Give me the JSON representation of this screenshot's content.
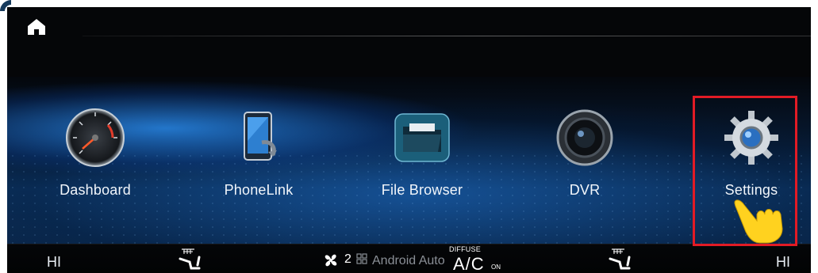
{
  "header": {
    "home_icon": "home-icon"
  },
  "apps": [
    {
      "label": "Dashboard",
      "icon": "speedometer-icon"
    },
    {
      "label": "PhoneLink",
      "icon": "phone-link-icon"
    },
    {
      "label": "File Browser",
      "icon": "folder-icon"
    },
    {
      "label": "DVR",
      "icon": "camera-lens-icon"
    },
    {
      "label": "Settings",
      "icon": "gear-icon"
    }
  ],
  "annotation": {
    "highlight_color": "#e21b25",
    "pointer_icon": "pointing-hand-icon"
  },
  "climate": {
    "left_temp": "HI",
    "right_temp": "HI",
    "fan_level": "2",
    "android_auto": "Android Auto",
    "ac_label": "A/C",
    "diffuse_label": "DIFFUSE",
    "ac_state": "ON"
  }
}
